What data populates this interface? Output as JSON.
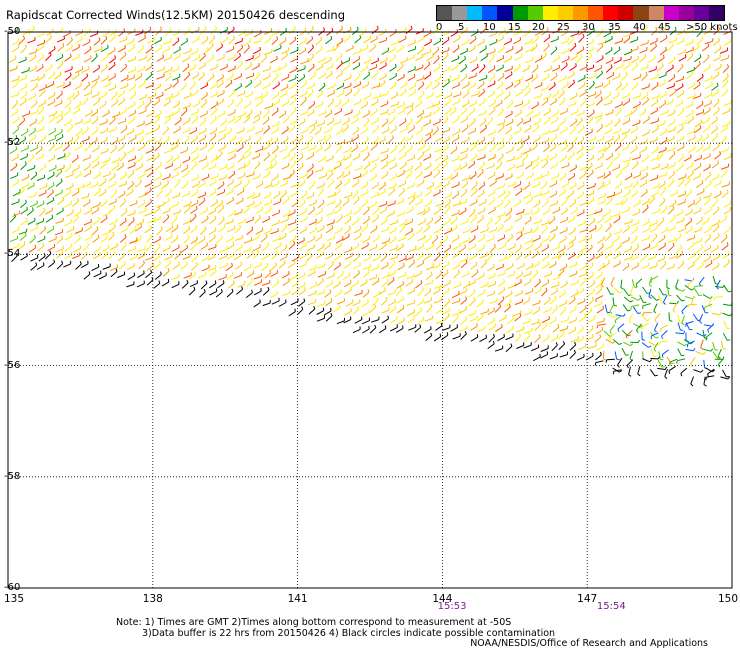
{
  "title": "Rapidscat Corrected Winds(12.5KM) 20150426 descending",
  "legend": {
    "colors": [
      "#555555",
      "#999999",
      "#00bbff",
      "#0055ff",
      "#000099",
      "#009900",
      "#55cc00",
      "#ffee00",
      "#ffcc00",
      "#ff9900",
      "#ff5500",
      "#ff0000",
      "#cc0000",
      "#8b4513",
      "#cc8866",
      "#cc00cc",
      "#990099",
      "#660099",
      "#330066"
    ],
    "labels": [
      "0",
      "5",
      "10",
      "15",
      "20",
      "25",
      "30",
      "35",
      "40",
      "45",
      ">50 knots"
    ]
  },
  "axes": {
    "x_ticks": [
      "135",
      "138",
      "141",
      "144",
      "147",
      "150"
    ],
    "y_ticks": [
      "-50",
      "-52",
      "-54",
      "-56",
      "-58",
      "-60"
    ],
    "x_range": [
      135,
      150
    ],
    "y_range": [
      -60,
      -50
    ]
  },
  "times": [
    {
      "label": "15:53",
      "lon": 144.2
    },
    {
      "label": "15:54",
      "lon": 147.5
    }
  ],
  "notes": [
    "Note: 1) Times are GMT 2)Times along bottom correspond to measurement at -50S",
    "3)Data buffer is 22 hrs from 20150426 4) Black circles indicate possible contamination"
  ],
  "credit": "NOAA/NESDIS/Office of Research and Applications",
  "swath": {
    "western_edge": [
      [
        135,
        -54.2
      ],
      [
        137.5,
        -54.6
      ],
      [
        140,
        -54.9
      ],
      [
        142,
        -55.4
      ],
      [
        144,
        -55.6
      ],
      [
        146,
        -55.9
      ],
      [
        148,
        -56.1
      ],
      [
        150,
        -56.3
      ]
    ],
    "speed_colors": [
      "#ffee00",
      "#ffcc00",
      "#ff9900",
      "#ff5500",
      "#ff0000",
      "#009900",
      "#55cc00",
      "#000000",
      "#0055ff"
    ]
  }
}
